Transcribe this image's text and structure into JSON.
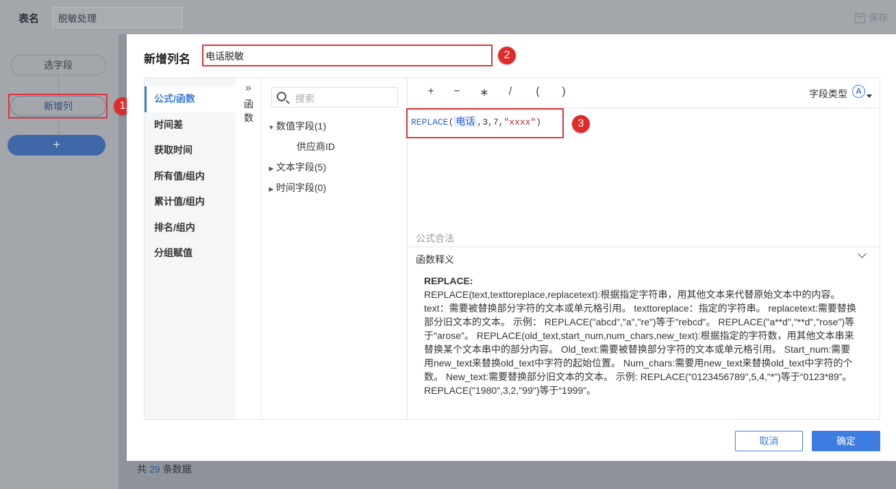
{
  "background": {
    "table_name_label": "表名",
    "table_name_value": "脱敏处理",
    "save_label": "保存",
    "steps": [
      "选字段",
      "新增列"
    ],
    "add_step_label": "+",
    "footer": {
      "prefix": "共",
      "count": "29",
      "suffix": "条数据"
    }
  },
  "dialog": {
    "title": "新增列名",
    "column_name_value": "电话脱敏",
    "categories": [
      "公式/函数",
      "时间差",
      "获取时间",
      "所有值/组内",
      "累计值/组内",
      "排名/组内",
      "分组赋值"
    ],
    "collapse_label": "函数",
    "search_placeholder": "搜索",
    "tree": {
      "numeric_group": "数值字段(1)",
      "numeric_child": "供应商ID",
      "text_group": "文本字段(5)",
      "time_group": "时间字段(0)"
    },
    "operators": [
      "+",
      "−",
      "∗",
      "/",
      "(",
      ")"
    ],
    "field_type_label": "字段类型",
    "field_type_icon": "A",
    "formula": {
      "fn": "REPLACE",
      "open": "(",
      "field": "电话",
      "args": ",3,7,",
      "str": "\"xxxx\"",
      "close": ")"
    },
    "validity": "公式合法",
    "help_title": "函数释义",
    "help_fn_name": "REPLACE:",
    "help_text": "REPLACE(text,texttoreplace,replacetext):根据指定字符串，用其他文本来代替原始文本中的内容。 text：需要被替换部分字符的文本或单元格引用。 texttoreplace：指定的字符串。 replacetext:需要替换部分旧文本的文本。 示例： REPLACE(\"abcd\",\"a\",\"re\")等于\"rebcd\"。 REPLACE(\"a**d\",\"**d\",\"rose\")等于\"arose\"。 REPLACE(old_text,start_num,num_chars,new_text):根据指定的字符数，用其他文本串来替换某个文本串中的部分内容。 Old_text:需要被替换部分字符的文本或单元格引用。 Start_num:需要用new_text来替换old_text中字符的起始位置。 Num_chars:需要用new_text来替换old_text中字符的个数。 New_text:需要替换部分旧文本的文本。 示例: REPLACE(\"0123456789\",5,4,\"*\")等于“0123*89”。 REPLACE(\"1980\",3,2,\"99\")等于“1999”。",
    "cancel_label": "取消",
    "ok_label": "确定"
  },
  "annotations": [
    "1",
    "2",
    "3"
  ],
  "colors": {
    "accent": "#3d7ce0",
    "highlight": "#e0323b",
    "badge": "#e02b2b"
  }
}
